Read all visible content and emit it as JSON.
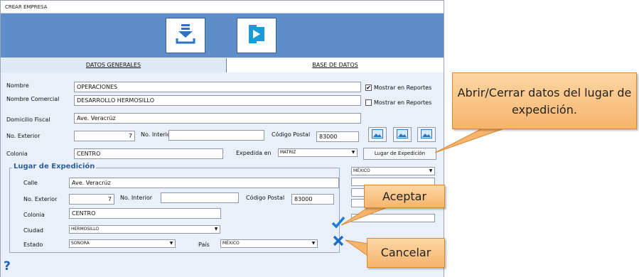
{
  "window": {
    "title": "CREAR EMPRESA"
  },
  "toolbar": {
    "download_icon": "download-stack-icon",
    "exit_icon": "exit-arrow-icon"
  },
  "tabs": [
    {
      "label": "DATOS GENERALES"
    },
    {
      "label": "BASE DE DATOS"
    }
  ],
  "form": {
    "nombre_label": "Nombre",
    "nombre_value": "OPERACIONES",
    "comercial_label": "Nombre Comercial",
    "comercial_value": "DESARROLLO HERMOSILLO",
    "mostrar1_label": "Mostrar en Reportes",
    "mostrar1_checked": true,
    "mostrar2_label": "Mostrar en Reportes",
    "mostrar2_checked": false,
    "domicilio_label": "Domicilio Fiscal",
    "domicilio_value": "Ave. Veracrúz",
    "exterior_label": "No. Exterior",
    "exterior_value": "7",
    "interior_label": "No. Interior",
    "interior_value": "",
    "cp_label": "Código Postal",
    "cp_value": "83000",
    "colonia_label": "Colonia",
    "colonia_value": "CENTRO",
    "expedida_label": "Expedida en",
    "expedida_value": "MATRIZ",
    "lugar_button": "Lugar de Expedición",
    "pais_top_value": "MÉXICO"
  },
  "lugar": {
    "legend": "Lugar de Expedición",
    "calle_label": "Calle",
    "calle_value": "Ave. Veracrúz",
    "exterior_label": "No. Exterior",
    "exterior_value": "7",
    "interior_label": "No. Interior",
    "interior_value": "",
    "cp_label": "Código Postal",
    "cp_value": "83000",
    "colonia_label": "Colonia",
    "colonia_value": "CENTRO",
    "ciudad_label": "Ciudad",
    "ciudad_value": "HERMOSILLO",
    "estado_label": "Estado",
    "estado_value": "SONORA",
    "pais_label": "País",
    "pais_value": "MÉXICO"
  },
  "help_label": "?",
  "callouts": {
    "lugar_note": "Abrir/Cerrar datos del lugar de expedición.",
    "aceptar": "Aceptar",
    "cancelar": "Cancelar"
  },
  "colors": {
    "toolbar": "#5d8ec7",
    "accent": "#2d5f9f",
    "callout": "#f6b46c",
    "check": "#1a7ed8"
  }
}
